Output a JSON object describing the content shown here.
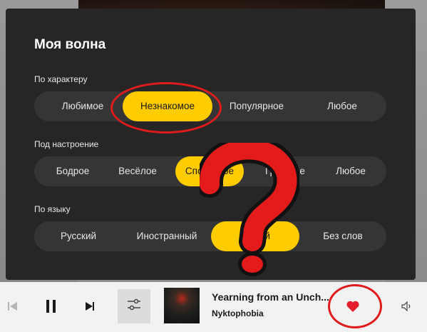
{
  "panel": {
    "title": "Моя волна",
    "sections": [
      {
        "label": "По характеру",
        "options": [
          "Любимое",
          "Незнакомое",
          "Популярное",
          "Любое"
        ],
        "selected": "Незнакомое"
      },
      {
        "label": "Под настроение",
        "options": [
          "Бодрое",
          "Весёлое",
          "Спокойное",
          "Грустное",
          "Любое"
        ],
        "selected": "Спокойное"
      },
      {
        "label": "По языку",
        "options": [
          "Русский",
          "Иностранный",
          "Любой",
          "Без слов"
        ],
        "selected": "Любой"
      }
    ]
  },
  "player": {
    "track_title": "Yearning from an Unch...",
    "artist": "Nyktophobia",
    "liked": true,
    "icons": [
      "prev-icon",
      "pause-icon",
      "next-icon",
      "equalizer-icon",
      "heart-icon",
      "volume-icon"
    ]
  },
  "colors": {
    "accent": "#ffcc00",
    "panel_bg": "#262626",
    "segment_bg": "#353535",
    "annotation": "#e01b1b",
    "heart": "#e31e2d"
  }
}
